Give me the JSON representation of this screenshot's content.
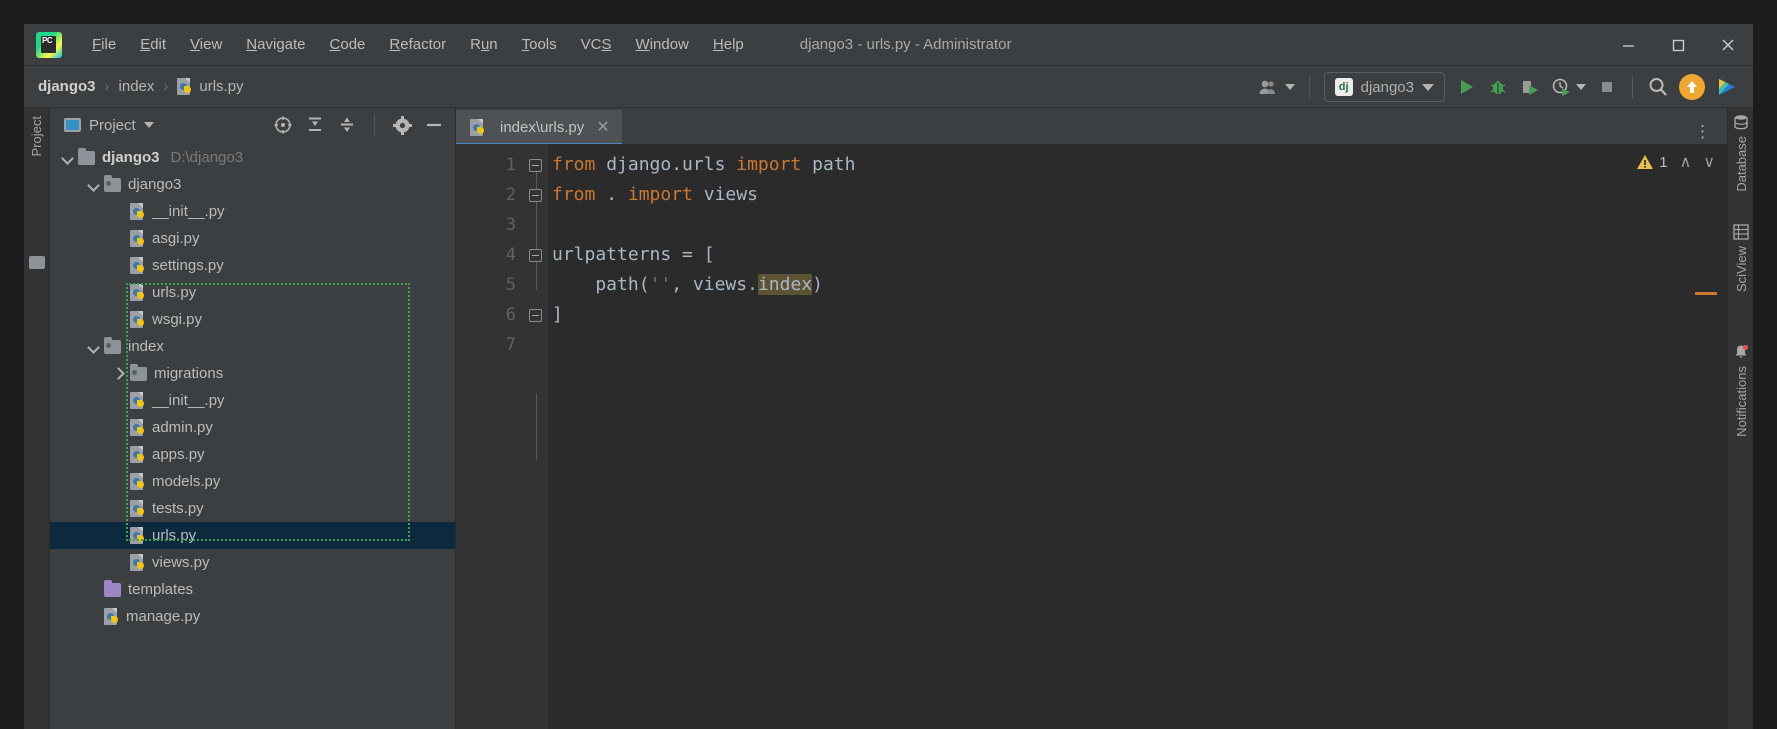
{
  "window": {
    "title": "django3 - urls.py - Administrator",
    "logo": "pycharm-logo",
    "minimize": "–",
    "maximize": "□",
    "close": "✕"
  },
  "menu": [
    {
      "label": "File",
      "accel": "F"
    },
    {
      "label": "Edit",
      "accel": "E"
    },
    {
      "label": "View",
      "accel": "V"
    },
    {
      "label": "Navigate",
      "accel": "N"
    },
    {
      "label": "Code",
      "accel": "C"
    },
    {
      "label": "Refactor",
      "accel": "R"
    },
    {
      "label": "Run",
      "accel": "u"
    },
    {
      "label": "Tools",
      "accel": "T"
    },
    {
      "label": "VCS",
      "accel": "S"
    },
    {
      "label": "Window",
      "accel": "W"
    },
    {
      "label": "Help",
      "accel": "H"
    }
  ],
  "breadcrumb": {
    "items": [
      "django3",
      "index",
      "urls.py"
    ],
    "separator": "›",
    "file_icon": "python-file-icon"
  },
  "toolbar": {
    "user_icon": "user-accounts-icon",
    "run_config": {
      "icon_text": "dj",
      "label": "django3",
      "dropdown": "chevron-down-icon"
    },
    "run": "run-icon",
    "debug": "debug-bug-icon",
    "coverage": "run-with-coverage-icon",
    "profile": "profile-icon",
    "stop": "stop-icon",
    "search": "search-icon",
    "update": "update-project-icon",
    "share": "share-icon"
  },
  "project_panel": {
    "title": "Project",
    "window_icon": "project-window-icon",
    "dropdown": "chevron-down-icon",
    "actions": [
      {
        "name": "select-opened-file-icon"
      },
      {
        "name": "expand-all-icon"
      },
      {
        "name": "collapse-all-icon"
      },
      {
        "name": "settings-gear-icon"
      },
      {
        "name": "hide-icon"
      }
    ],
    "tree": [
      {
        "label": "django3",
        "path": "D:\\django3",
        "type": "folder",
        "indent": 0,
        "expander": "down",
        "bold": true
      },
      {
        "label": "django3",
        "path": "",
        "type": "module-folder",
        "indent": 1,
        "expander": "down",
        "bold": false
      },
      {
        "label": "__init__.py",
        "path": "",
        "type": "python",
        "indent": 2,
        "expander": "none",
        "bold": false
      },
      {
        "label": "asgi.py",
        "path": "",
        "type": "python",
        "indent": 2,
        "expander": "none",
        "bold": false
      },
      {
        "label": "settings.py",
        "path": "",
        "type": "python",
        "indent": 2,
        "expander": "none",
        "bold": false
      },
      {
        "label": "urls.py",
        "path": "",
        "type": "python",
        "indent": 2,
        "expander": "none",
        "bold": false
      },
      {
        "label": "wsgi.py",
        "path": "",
        "type": "python",
        "indent": 2,
        "expander": "none",
        "bold": false
      },
      {
        "label": "index",
        "path": "",
        "type": "module-folder",
        "indent": 1,
        "expander": "down",
        "bold": false
      },
      {
        "label": "migrations",
        "path": "",
        "type": "module-folder",
        "indent": 2,
        "expander": "right",
        "bold": false
      },
      {
        "label": "__init__.py",
        "path": "",
        "type": "python",
        "indent": 2,
        "expander": "none",
        "bold": false
      },
      {
        "label": "admin.py",
        "path": "",
        "type": "python",
        "indent": 2,
        "expander": "none",
        "bold": false
      },
      {
        "label": "apps.py",
        "path": "",
        "type": "python",
        "indent": 2,
        "expander": "none",
        "bold": false
      },
      {
        "label": "models.py",
        "path": "",
        "type": "python",
        "indent": 2,
        "expander": "none",
        "bold": false
      },
      {
        "label": "tests.py",
        "path": "",
        "type": "python",
        "indent": 2,
        "expander": "none",
        "bold": false
      },
      {
        "label": "urls.py",
        "path": "",
        "type": "python",
        "indent": 2,
        "expander": "none",
        "bold": false,
        "selected": true
      },
      {
        "label": "views.py",
        "path": "",
        "type": "python",
        "indent": 2,
        "expander": "none",
        "bold": false
      },
      {
        "label": "templates",
        "path": "",
        "type": "folder-purple",
        "indent": 1,
        "expander": "none",
        "bold": false
      },
      {
        "label": "manage.py",
        "path": "",
        "type": "python",
        "indent": 1,
        "expander": "none",
        "bold": false
      }
    ],
    "annotation": {
      "color": "#3fa34d",
      "style": "dotted"
    }
  },
  "editor": {
    "tab": {
      "label": "index\\urls.py",
      "icon": "python-file-icon",
      "close": "✕"
    },
    "tab_options": "⋮",
    "line_numbers": [
      "1",
      "2",
      "3",
      "4",
      "5",
      "6",
      "7"
    ],
    "lines": [
      {
        "n": "1",
        "tokens": [
          {
            "t": "from",
            "c": "kw"
          },
          {
            "t": " django.urls ",
            "c": "id"
          },
          {
            "t": "import",
            "c": "kw"
          },
          {
            "t": " path",
            "c": "id"
          }
        ]
      },
      {
        "n": "2",
        "tokens": [
          {
            "t": "from",
            "c": "kw"
          },
          {
            "t": " . ",
            "c": "id"
          },
          {
            "t": "import",
            "c": "kw"
          },
          {
            "t": " views",
            "c": "id"
          }
        ]
      },
      {
        "n": "3",
        "tokens": []
      },
      {
        "n": "4",
        "tokens": [
          {
            "t": "urlpatterns = [",
            "c": "id"
          }
        ]
      },
      {
        "n": "5",
        "tokens": [
          {
            "t": "    path(",
            "c": "id"
          },
          {
            "t": "''",
            "c": "str"
          },
          {
            "t": ", views.",
            "c": "id"
          },
          {
            "t": "index",
            "c": "hl"
          },
          {
            "t": ")",
            "c": "id"
          }
        ]
      },
      {
        "n": "6",
        "tokens": [
          {
            "t": "]",
            "c": "id"
          }
        ]
      },
      {
        "n": "7",
        "tokens": []
      }
    ],
    "inspection": {
      "icon": "warning-triangle-icon",
      "count": "1",
      "prev": "∧",
      "next": "∨"
    }
  },
  "tool_windows": {
    "left": [
      {
        "label": "Project",
        "icon": "project-icon"
      }
    ],
    "right": [
      {
        "label": "Database",
        "icon": "database-icon"
      },
      {
        "label": "SciView",
        "icon": "sciview-icon"
      },
      {
        "label": "Notifications",
        "icon": "notifications-icon"
      }
    ]
  },
  "colors": {
    "panel_bg": "#3c3f41",
    "editor_bg": "#2b2b2b",
    "selection": "#0d293e",
    "keyword": "#cc7832",
    "string": "#6a8759",
    "identifier": "#a9b7c6",
    "highlight": "#5b5334",
    "accent": "#4a88c7",
    "annotation_green": "#3fa34d",
    "run_green": "#499c54",
    "update_orange": "#f0a732"
  }
}
